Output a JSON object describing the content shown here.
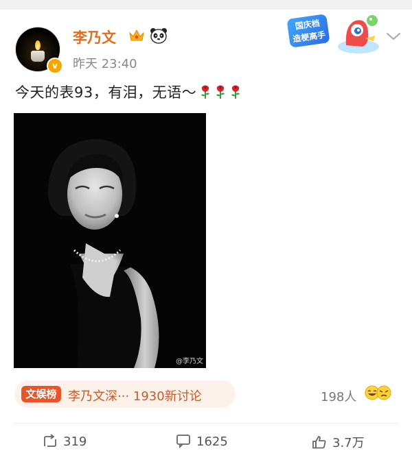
{
  "post": {
    "username": "李乃文",
    "time": "昨天 23:40",
    "verify_mark": "v",
    "text": "今天的表93，有泪，无语～",
    "roses": [
      "rose-icon",
      "rose-icon",
      "rose-icon"
    ],
    "watermark": "@李乃文"
  },
  "promo": {
    "line1": "国庆档",
    "line2": "造梗高手"
  },
  "ranking": {
    "badge": "文娱榜",
    "text": "李乃文深··· 1930新讨论"
  },
  "likes": {
    "count": "198人"
  },
  "actions": {
    "repost": "319",
    "comment": "1625",
    "like": "3.7万"
  },
  "colors": {
    "username": "#e86b1b",
    "badge": "#e8552a",
    "ranking_bg": "#fdf2ea"
  }
}
